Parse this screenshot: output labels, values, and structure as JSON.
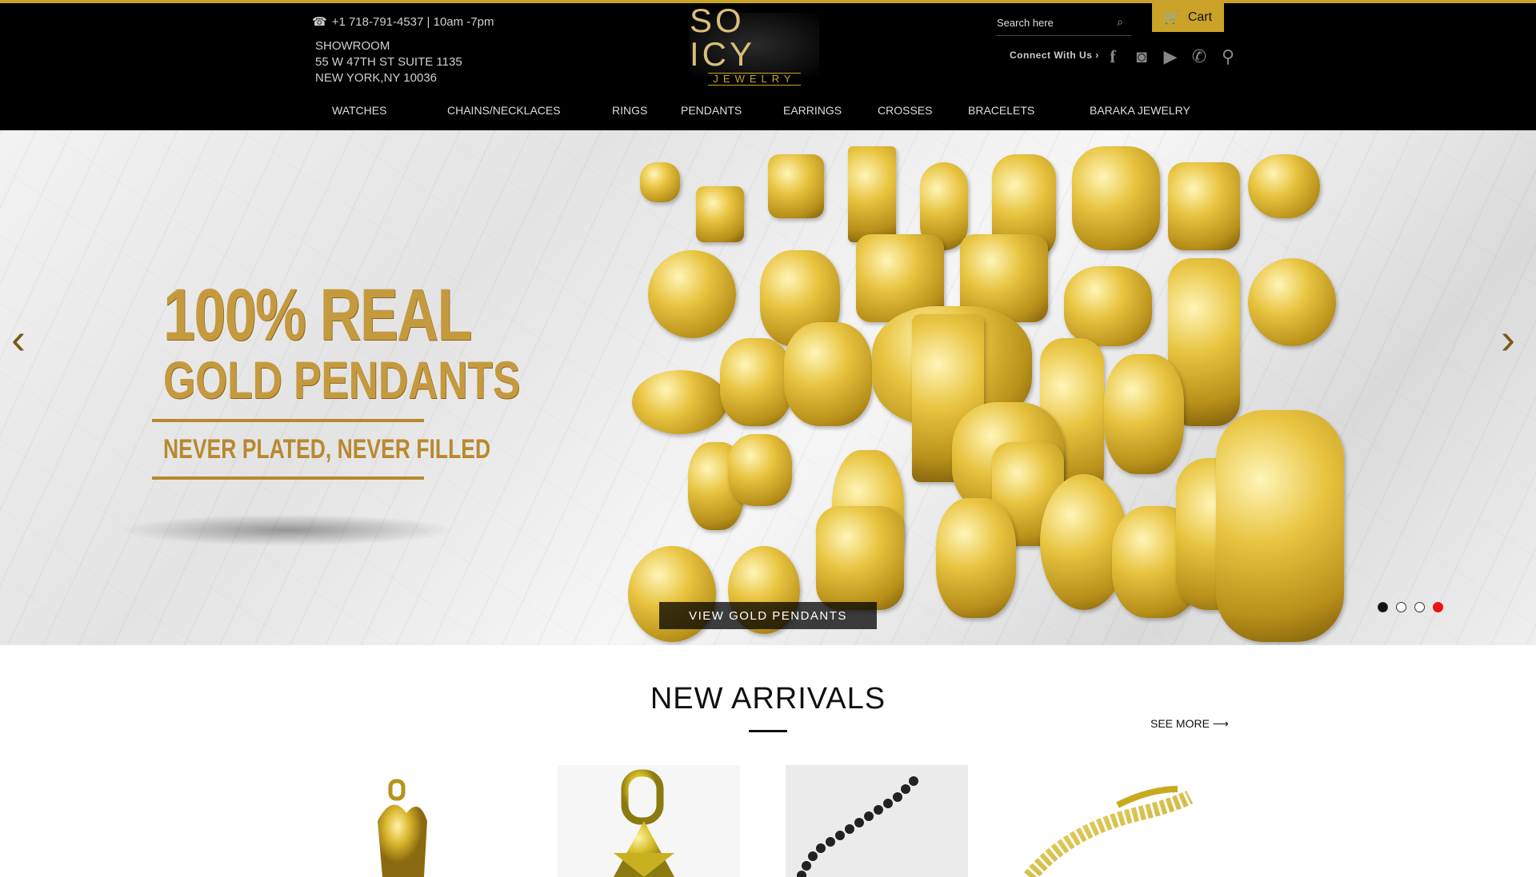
{
  "header": {
    "phone": "+1 718-791-4537 | 10am -7pm",
    "showroom_lines": [
      "SHOWROOM",
      "55 W 47TH ST SUITE 1135",
      "NEW YORK,NY 10036"
    ],
    "logo_main": "SO ICY",
    "logo_sub": "JEWELRY",
    "search_placeholder": "Search here",
    "cart_label": "Cart",
    "connect_label": "Connect With Us ›",
    "social_icons": [
      "facebook-icon",
      "instagram-icon",
      "youtube-icon",
      "whatsapp-icon",
      "map-pin-icon"
    ]
  },
  "nav": {
    "items": [
      "WATCHES",
      "CHAINS/NECKLACES",
      "RINGS",
      "PENDANTS",
      "EARRINGS",
      "CROSSES",
      "BRACELETS",
      "BARAKA JEWELRY"
    ]
  },
  "hero": {
    "line1": "100% REAL",
    "line2": "GOLD PENDANTS",
    "line3": "NEVER PLATED, NEVER FILLED",
    "cta": "VIEW GOLD PENDANTS",
    "slide_count": 4,
    "active_slide": 4
  },
  "arrivals": {
    "title": "NEW ARRIVALS",
    "see_more": "SEE MORE"
  },
  "colors": {
    "gold": "#c9a227",
    "header_bg": "#000000"
  }
}
